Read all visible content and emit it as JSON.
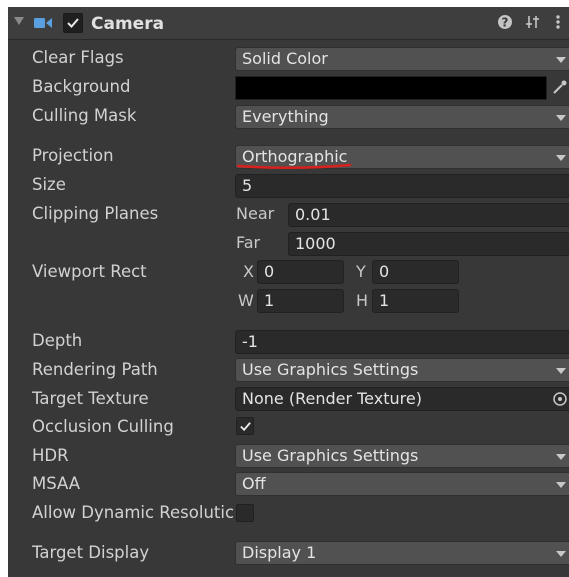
{
  "header": {
    "title": "Camera",
    "enabled": true,
    "icons": [
      "camera-icon",
      "help-icon",
      "preset-icon",
      "more-menu-icon"
    ]
  },
  "fields": {
    "clear_flags": {
      "label": "Clear Flags",
      "value": "Solid Color"
    },
    "background": {
      "label": "Background",
      "color": "#000000"
    },
    "culling_mask": {
      "label": "Culling Mask",
      "value": "Everything"
    },
    "projection": {
      "label": "Projection",
      "value": "Orthographic"
    },
    "size": {
      "label": "Size",
      "value": "5"
    },
    "clipping_planes": {
      "label": "Clipping Planes",
      "near_label": "Near",
      "near": "0.01",
      "far_label": "Far",
      "far": "1000"
    },
    "viewport_rect": {
      "label": "Viewport Rect",
      "x_label": "X",
      "x": "0",
      "y_label": "Y",
      "y": "0",
      "w_label": "W",
      "w": "1",
      "h_label": "H",
      "h": "1"
    },
    "depth": {
      "label": "Depth",
      "value": "-1"
    },
    "rendering_path": {
      "label": "Rendering Path",
      "value": "Use Graphics Settings"
    },
    "target_texture": {
      "label": "Target Texture",
      "value": "None (Render Texture)"
    },
    "occlusion_culling": {
      "label": "Occlusion Culling",
      "checked": true
    },
    "hdr": {
      "label": "HDR",
      "value": "Use Graphics Settings"
    },
    "msaa": {
      "label": "MSAA",
      "value": "Off"
    },
    "allow_dynamic_resolution": {
      "label": "Allow Dynamic Resolutic",
      "checked": false
    },
    "target_display": {
      "label": "Target Display",
      "value": "Display 1"
    }
  },
  "colors": {
    "panel_bg": "#383838",
    "field_bg": "#2a2a2a",
    "dropdown_bg": "#515151",
    "annotation_underline": "#d9201c"
  }
}
